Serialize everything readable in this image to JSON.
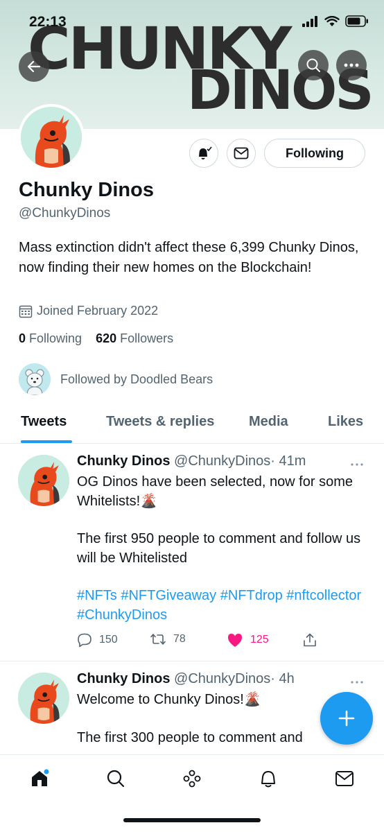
{
  "status_bar": {
    "time": "22:13"
  },
  "banner": {
    "line1": "CHUNKY",
    "line2": "DINOS"
  },
  "profile": {
    "name": "Chunky Dinos",
    "handle": "@ChunkyDinos",
    "bio": "Mass extinction didn't affect these 6,399 Chunky Dinos, now finding their new homes on the Blockchain!",
    "joined": "Joined February 2022",
    "following_count": "0",
    "following_label": "Following",
    "followers_count": "620",
    "followers_label": "Followers",
    "followed_by": "Followed by Doodled Bears",
    "follow_button": "Following"
  },
  "tabs": [
    {
      "label": "Tweets",
      "active": true
    },
    {
      "label": "Tweets & replies"
    },
    {
      "label": "Media"
    },
    {
      "label": "Likes"
    }
  ],
  "tweets": [
    {
      "name": "Chunky Dinos",
      "handle": "@ChunkyDinos",
      "time": "· 41m",
      "text1": "OG Dinos have been selected, now for some Whitelists!🌋",
      "text2": "The first 950 people to comment and follow us will be Whitelisted",
      "hashtags": "#NFTs #NFTGiveaway #NFTdrop #nftcollector #ChunkyDinos",
      "replies": "150",
      "retweets": "78",
      "likes": "125"
    },
    {
      "name": "Chunky Dinos",
      "handle": "@ChunkyDinos",
      "time": "· 4h",
      "text1": "Welcome to Chunky Dinos!🌋",
      "text2": "The first 300 people to comment and"
    }
  ],
  "colors": {
    "accent": "#1d9bf0",
    "like": "#f91880",
    "banner_bg": "#c4ddd6"
  },
  "icons": [
    "back-arrow-icon",
    "search-icon",
    "more-icon",
    "notification-bell-icon",
    "message-icon",
    "calendar-icon",
    "reply-icon",
    "retweet-icon",
    "heart-icon",
    "share-icon",
    "compose-icon",
    "home-icon",
    "spaces-icon"
  ]
}
